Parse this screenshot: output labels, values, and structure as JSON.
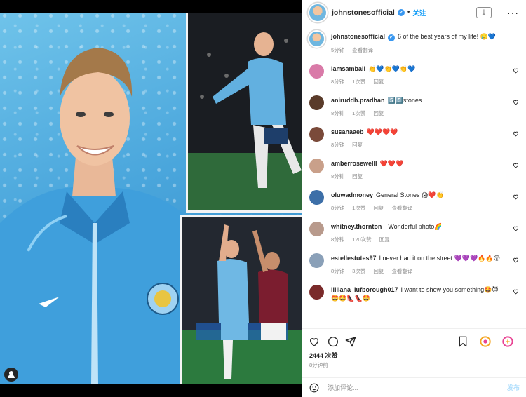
{
  "header": {
    "username": "johnstonesofficial",
    "verified_mark": "✔",
    "separator": "•",
    "follow_label": "关注",
    "download_icon": "⤓",
    "more_icon": "···"
  },
  "caption": {
    "username": "johnstonesofficial",
    "text": "6 of the best years of my life! 🥲💙",
    "time": "5分钟",
    "translate": "查看翻译"
  },
  "comments": [
    {
      "username": "iamsamball",
      "text": "👏💙👏💙👏💙",
      "time": "8分钟",
      "likes": "1次赞",
      "reply": "回复",
      "avatar_color": "#d97aa8"
    },
    {
      "username": "aniruddh.pradhan",
      "text": "5️⃣5️⃣stones",
      "time": "8分钟",
      "likes": "1次赞",
      "reply": "回复",
      "avatar_color": "#5a3b2a"
    },
    {
      "username": "susanaaeb",
      "text": "❤️❤️❤️❤️",
      "time": "8分钟",
      "likes": "",
      "reply": "回复",
      "avatar_color": "#7a4a3a"
    },
    {
      "username": "amberrosewelll",
      "text": "❤️❤️❤️",
      "time": "8分钟",
      "likes": "",
      "reply": "回复",
      "avatar_color": "#c9a08a"
    },
    {
      "username": "oluwadmoney",
      "text": "General Stones 😱❤️👏",
      "time": "8分钟",
      "likes": "1次赞",
      "reply": "回复",
      "translate": "查看翻译",
      "avatar_color": "#3d6fa8"
    },
    {
      "username": "whitney.thornton_",
      "text": "Wonderful photo🌈",
      "time": "8分钟",
      "likes": "120次赞",
      "reply": "回复",
      "avatar_color": "#b89a8c"
    },
    {
      "username": "estellestutes97",
      "text": "I never had it on the street 💜💜💜🔥🔥😵",
      "time": "8分钟",
      "likes": "3次赞",
      "reply": "回复",
      "translate": "查看翻译",
      "avatar_color": "#8aa0b8"
    },
    {
      "username": "lilliana_lufborough017",
      "text": "I want to show you something🤩😈 🤩🤩👠👠🤩",
      "time": "",
      "likes": "",
      "reply": "",
      "avatar_color": "#7a2a2a"
    }
  ],
  "footer": {
    "likes": "2444 次赞",
    "time": "8分钟前",
    "comment_placeholder": "添加评论...",
    "post_label": "发布"
  },
  "colors": {
    "accent": "#0095f6",
    "verified": "#3897f0",
    "photo_bg": "#4aa6dc"
  }
}
